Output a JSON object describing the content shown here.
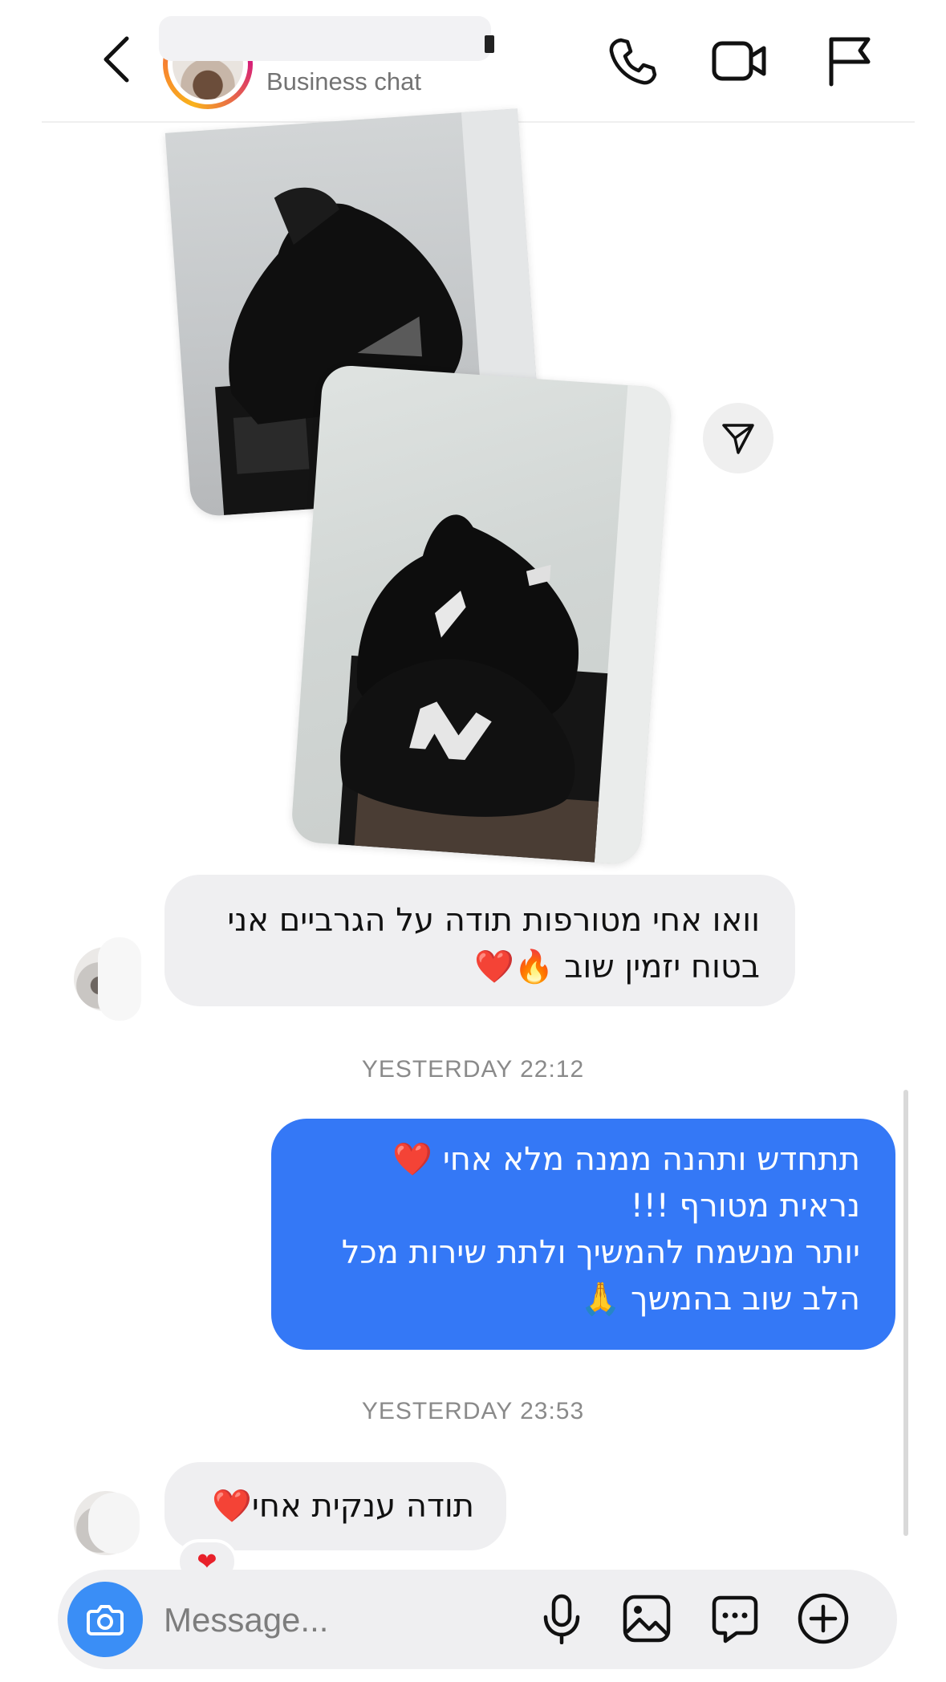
{
  "header": {
    "subtitle": "Business chat",
    "icons": [
      "back-arrow-icon",
      "phone-icon",
      "video-call-icon",
      "flag-icon"
    ]
  },
  "conversation": {
    "shared_media": {
      "icons": [
        "paper-plane-icon"
      ]
    },
    "messages": [
      {
        "direction": "incoming",
        "lines": [
          "וואו אחי מטורפות תודה על הגרביים אני",
          "בטוח יזמין שוב 🔥❤️"
        ]
      },
      {
        "timestamp": "YESTERDAY 22:12"
      },
      {
        "direction": "outgoing",
        "lines": [
          "תתחדש ותהנה ממנה מלא אחי ❤️",
          "נראית מטורף !!!",
          "יותר מנשמח להמשיך ולתת שירות מכל",
          "הלב שוב בהמשך 🙏"
        ]
      },
      {
        "timestamp": "YESTERDAY 23:53"
      },
      {
        "direction": "incoming",
        "lines": [
          "תודה ענקית אחי❤️"
        ],
        "reaction": "❤"
      }
    ]
  },
  "composer": {
    "placeholder": "Message...",
    "icons": [
      "camera-icon",
      "microphone-icon",
      "gallery-icon",
      "sticker-chat-icon",
      "plus-icon"
    ]
  },
  "colors": {
    "outgoing_bubble": "#3478f6",
    "incoming_bubble": "#efeff1",
    "camera_button": "#3a8ef6",
    "reaction_heart": "#e8202a"
  }
}
